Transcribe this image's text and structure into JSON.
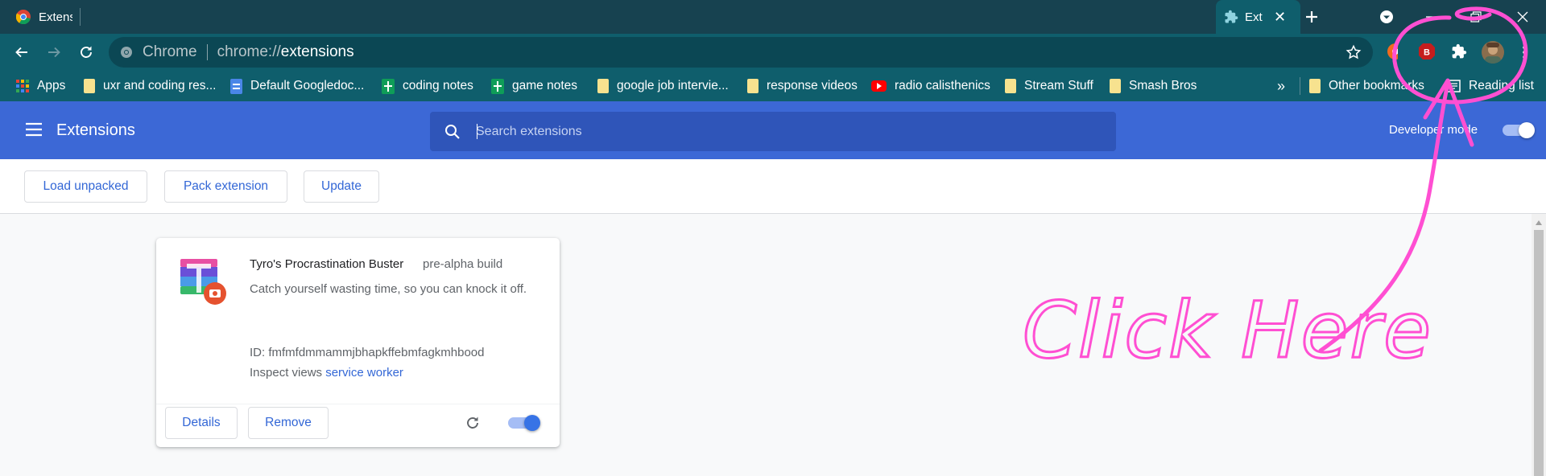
{
  "browser": {
    "tabs": [
      {
        "title": "Extensions",
        "active": false
      },
      {
        "title": "Extensions",
        "active": true
      }
    ],
    "omnibox": {
      "site_label": "Chrome",
      "url_scheme": "chrome://",
      "url_path": "extensions"
    },
    "bookmarks": [
      {
        "label": "Apps",
        "icon": "apps-grid-icon"
      },
      {
        "label": "uxr and coding res...",
        "icon": "folder-icon"
      },
      {
        "label": "Default Googledoc...",
        "icon": "google-docs-icon"
      },
      {
        "label": "coding notes",
        "icon": "google-sheets-icon"
      },
      {
        "label": "game notes",
        "icon": "google-sheets-icon"
      },
      {
        "label": "google job intervie...",
        "icon": "folder-icon"
      },
      {
        "label": "response videos",
        "icon": "folder-icon"
      },
      {
        "label": "radio calisthenics",
        "icon": "youtube-icon"
      },
      {
        "label": "Stream Stuff",
        "icon": "folder-icon"
      },
      {
        "label": "Smash Bros",
        "icon": "folder-icon"
      }
    ],
    "overflow_label": "»",
    "other_bookmarks": "Other bookmarks",
    "reading_list": "Reading list"
  },
  "extensions_page": {
    "title": "Extensions",
    "search_placeholder": "Search extensions",
    "developer_mode_label": "Developer mode",
    "developer_mode_on": true,
    "toolbar": {
      "load_unpacked": "Load unpacked",
      "pack_extension": "Pack extension",
      "update": "Update"
    },
    "card": {
      "name": "Tyro's Procrastination Buster",
      "version": "pre-alpha build",
      "description": "Catch yourself wasting time, so you can knock it off.",
      "id_text": "ID: fmfmfdmmammjbhapkffebmfagkmhbood",
      "inspect_label": "Inspect views",
      "inspect_link": "service worker",
      "details": "Details",
      "remove": "Remove",
      "enabled": true
    }
  },
  "annotation": {
    "text": "Click Here",
    "color": "#ff4fd2"
  },
  "colors": {
    "tabstrip": "#174250",
    "toolbar": "#0f5e6c",
    "header": "#3c68d6",
    "accent": "#3367d6"
  }
}
